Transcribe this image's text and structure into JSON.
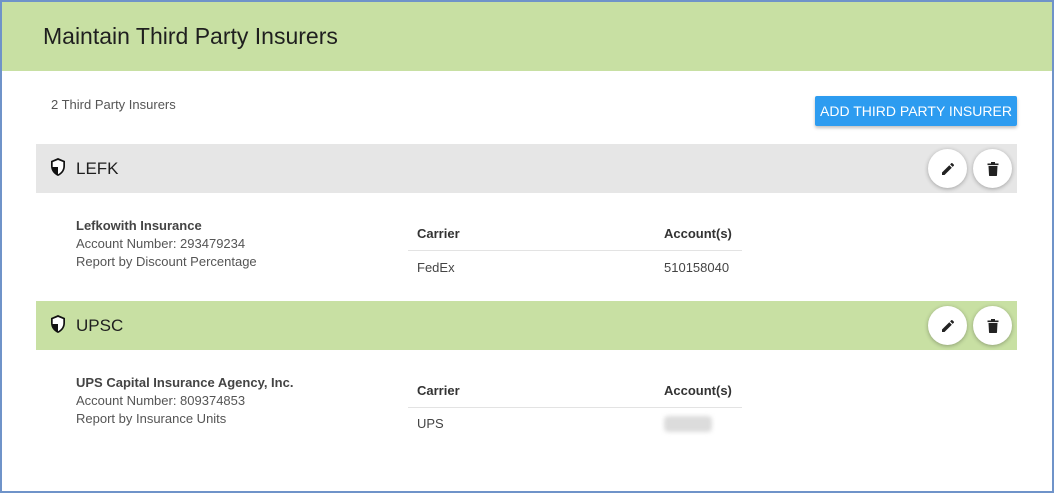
{
  "page": {
    "title": "Maintain Third Party Insurers",
    "count_text": "2 Third Party Insurers",
    "add_button_label": "ADD THIRD PARTY INSURER"
  },
  "insurers": [
    {
      "code": "LEFK",
      "name": "Lefkowith Insurance",
      "account_number": "Account Number: 293479234",
      "report_by": "Report by Discount Percentage",
      "table": {
        "carrier_header": "Carrier",
        "accounts_header": "Account(s)",
        "rows": [
          {
            "carrier": "FedEx",
            "accounts": "510158040"
          }
        ]
      }
    },
    {
      "code": "UPSC",
      "name": "UPS Capital Insurance Agency, Inc.",
      "account_number": "Account Number: 809374853",
      "report_by": "Report by Insurance Units",
      "table": {
        "carrier_header": "Carrier",
        "accounts_header": "Account(s)",
        "rows": [
          {
            "carrier": "UPS",
            "accounts": ""
          }
        ]
      }
    }
  ],
  "icons": {
    "shield": "shield-icon",
    "edit": "pencil-icon",
    "delete": "trash-icon"
  },
  "colors": {
    "header_green": "#c8e0a3",
    "row_gray": "#e6e6e6",
    "button_blue": "#2d9cf0",
    "frame_border": "#6f93c9"
  }
}
